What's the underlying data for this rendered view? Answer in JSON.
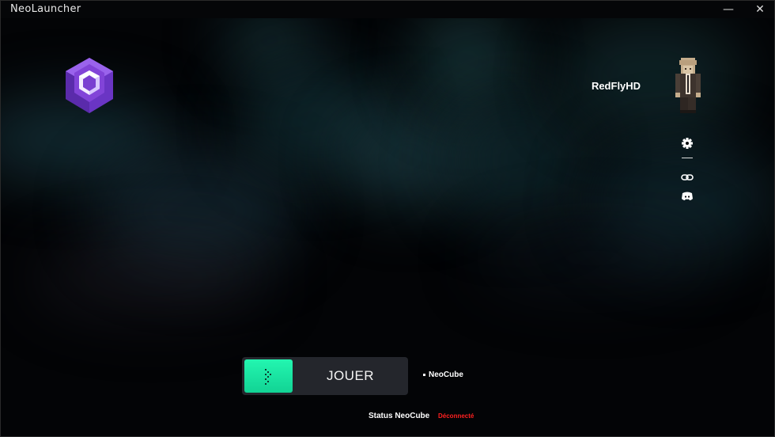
{
  "app": {
    "title": "NeoLauncher",
    "minimize_glyph": "—",
    "close_glyph": "✕"
  },
  "user": {
    "name": "RedFlyHD"
  },
  "sidebar": {
    "icons": [
      "gear-icon",
      "link-icon",
      "discord-icon"
    ]
  },
  "play": {
    "label": "JOUER"
  },
  "server": {
    "name": "NeoCube"
  },
  "status": {
    "label": "Status NeoCube",
    "value": "Déconnecté"
  },
  "colors": {
    "accent": "#1ee8a6",
    "status_offline": "#ff2020",
    "logo_purple": "#7a3fd1"
  }
}
